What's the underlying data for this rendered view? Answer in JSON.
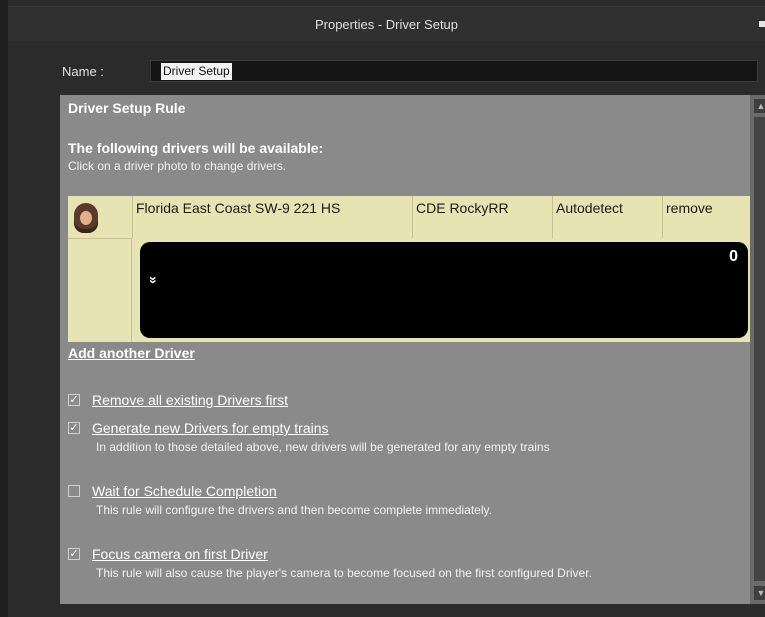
{
  "window": {
    "title": "Properties - Driver Setup"
  },
  "form": {
    "name_label": "Name :",
    "name_value": "Driver Setup"
  },
  "rule": {
    "title": "Driver Setup Rule",
    "available_heading": "The following drivers will be available:",
    "hint": "Click on a driver photo to change drivers.",
    "drivers": [
      {
        "train": "Florida East Coast SW-9 221 HS",
        "driver": "CDE RockyRR",
        "mode": "Autodetect",
        "action": "remove",
        "count": "0",
        "expand_glyph": "»"
      }
    ],
    "add_driver": "Add another Driver"
  },
  "options": [
    {
      "label": "Remove all existing Drivers first",
      "checked": true,
      "description": ""
    },
    {
      "label": "Generate new Drivers for empty trains",
      "checked": true,
      "description": "In addition to those detailed above, new drivers will be generated for any empty trains"
    },
    {
      "label": "Wait for Schedule Completion",
      "checked": false,
      "description": "This rule will configure the drivers and then become complete immediately."
    },
    {
      "label": "Focus camera on first Driver",
      "checked": true,
      "description": "This rule will also cause the player's camera to become focused on the first configured Driver."
    }
  ],
  "scrollbar": {
    "up_glyph": "▲",
    "down_glyph": "▼"
  },
  "check_glyph": "✓"
}
